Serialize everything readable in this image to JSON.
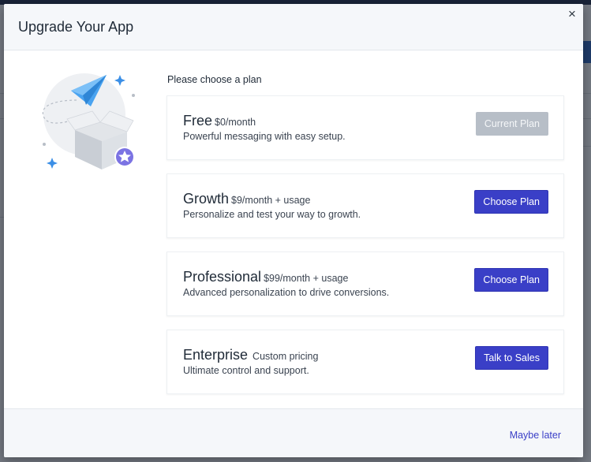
{
  "background": {
    "topbar_color": "#1f2d4d",
    "accent_strip_color": "#2b63b8"
  },
  "modal": {
    "title": "Upgrade Your App",
    "close_label": "×",
    "prompt": "Please choose a plan",
    "illustration_icon": "paper-plane-box-star",
    "plans": [
      {
        "name": "Free",
        "price": "$0/month",
        "description": "Powerful messaging with easy setup.",
        "button_label": "Current Plan",
        "button_enabled": false
      },
      {
        "name": "Growth",
        "price": "$9/month + usage",
        "description": "Personalize and test your way to growth.",
        "button_label": "Choose Plan",
        "button_enabled": true
      },
      {
        "name": "Professional",
        "price": "$99/month + usage",
        "description": "Advanced personalization to drive conversions.",
        "button_label": "Choose Plan",
        "button_enabled": true
      },
      {
        "name": "Enterprise",
        "price": "Custom pricing",
        "description": "Ultimate control and support.",
        "button_label": "Talk to Sales",
        "button_enabled": true
      }
    ],
    "footer_link": "Maybe later"
  },
  "colors": {
    "primary_button": "#3a3fc7",
    "disabled_button": "#b7bec7",
    "link": "#3a3fc7"
  }
}
